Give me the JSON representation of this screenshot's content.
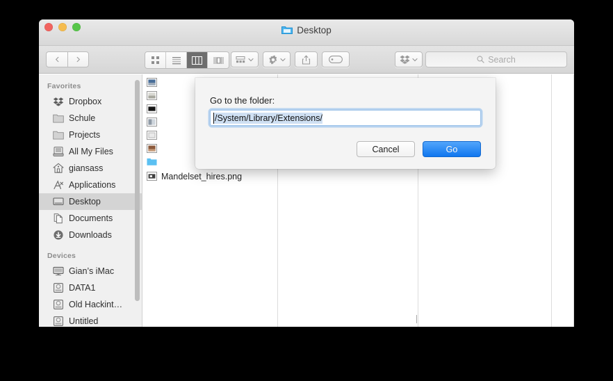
{
  "window": {
    "title": "Desktop",
    "title_icon": "blue-folder-icon",
    "traffic_lights": [
      "close-red",
      "minimize-yellow",
      "zoom-green"
    ]
  },
  "toolbar": {
    "back_label": "‹",
    "forward_label": "›",
    "view_buttons": [
      {
        "name": "icon-view",
        "icon": "grid-icon",
        "active": false
      },
      {
        "name": "list-view",
        "icon": "list-icon",
        "active": false
      },
      {
        "name": "column-view",
        "icon": "columns-icon",
        "active": true
      },
      {
        "name": "coverflow-view",
        "icon": "coverflow-icon",
        "active": false
      }
    ],
    "arrange_icon": "arrange-icon",
    "action_icon": "gear-icon",
    "share_icon": "share-icon",
    "tag_icon": "tag-icon",
    "dropbox_icon": "dropbox-icon",
    "search": {
      "placeholder": "Search",
      "icon": "search-icon",
      "value": ""
    }
  },
  "sidebar": {
    "sections": [
      {
        "header": "Favorites",
        "items": [
          {
            "label": "Dropbox",
            "icon": "dropbox-icon",
            "selected": false
          },
          {
            "label": "Schule",
            "icon": "folder-icon",
            "selected": false
          },
          {
            "label": "Projects",
            "icon": "folder-icon",
            "selected": false
          },
          {
            "label": "All My Files",
            "icon": "allmyfiles-icon",
            "selected": false
          },
          {
            "label": "giansass",
            "icon": "home-icon",
            "selected": false
          },
          {
            "label": "Applications",
            "icon": "applications-icon",
            "selected": false
          },
          {
            "label": "Desktop",
            "icon": "desktop-icon",
            "selected": true
          },
          {
            "label": "Documents",
            "icon": "documents-icon",
            "selected": false
          },
          {
            "label": "Downloads",
            "icon": "downloads-icon",
            "selected": false
          }
        ]
      },
      {
        "header": "Devices",
        "items": [
          {
            "label": "Gian’s iMac",
            "icon": "imac-icon",
            "selected": false
          },
          {
            "label": "DATA1",
            "icon": "disk-icon",
            "selected": false
          },
          {
            "label": "Old Hackint…",
            "icon": "disk-icon",
            "selected": false
          },
          {
            "label": "Untitled",
            "icon": "disk-icon",
            "selected": false
          }
        ]
      }
    ]
  },
  "file_column": {
    "rows": [
      {
        "label": "",
        "icon": "image-thumb-icon"
      },
      {
        "label": "",
        "icon": "image-thumb-icon"
      },
      {
        "label": "",
        "icon": "image-thumb-icon"
      },
      {
        "label": "",
        "icon": "image-thumb-icon"
      },
      {
        "label": "",
        "icon": "image-thumb-icon"
      },
      {
        "label": "",
        "icon": "image-thumb-icon"
      },
      {
        "label": "",
        "icon": "blue-folder-icon"
      },
      {
        "label": "Mandelset_hires.png",
        "icon": "image-thumb-icon"
      }
    ],
    "visible_filename": "Mandelset_hires.png"
  },
  "dialog": {
    "label": "Go to the folder:",
    "path_value": "/System/Library/Extensions/",
    "cancel_label": "Cancel",
    "go_label": "Go"
  },
  "colors": {
    "accent_blue": "#1077ef",
    "selection_blue": "#cfe0f3",
    "focus_ring": "#6aa9e9",
    "sidebar_bg": "#f0f0f0",
    "sidebar_selected": "#d4d4d4",
    "folder_blue": "#4db5ef"
  }
}
